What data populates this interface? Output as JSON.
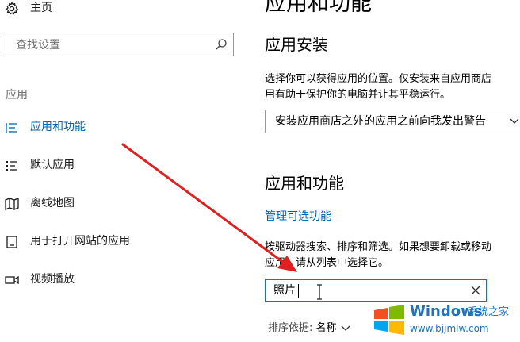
{
  "sidebar": {
    "home_label": "主页",
    "search_placeholder": "查找设置",
    "section_label": "应用",
    "items": [
      {
        "label": "应用和功能",
        "icon": "list-icon",
        "active": true
      },
      {
        "label": "默认应用",
        "icon": "default-apps-icon",
        "active": false
      },
      {
        "label": "离线地图",
        "icon": "map-icon",
        "active": false
      },
      {
        "label": "用于打开网站的应用",
        "icon": "website-apps-icon",
        "active": false
      },
      {
        "label": "视频播放",
        "icon": "video-icon",
        "active": false
      }
    ]
  },
  "main": {
    "page_title": "应用和功能",
    "install_heading": "应用安装",
    "install_desc_line1": "选择你可以获得应用的位置。仅安装来自应用商店",
    "install_desc_line2": "用有助于保护你的电脑并让其平稳运行。",
    "install_dropdown_value": "安装应用商店之外的应用之前向我发出警告",
    "apps_heading": "应用和功能",
    "optional_features_link": "管理可选功能",
    "filter_desc_line1": "按驱动器搜索、排序和筛选。如果想要卸载或移动",
    "filter_desc_line2": "应用，请从列表中选择它。",
    "filter_input_value": "照片",
    "sort_label": "排序依据:",
    "sort_value": "名称"
  },
  "watermark": {
    "brand": "Windows",
    "brand_cn": "系统之家",
    "url": "www.bjjmlw.com"
  },
  "colors": {
    "accent": "#0078d7",
    "link": "#0063b1",
    "annotation_arrow": "#e02020"
  }
}
